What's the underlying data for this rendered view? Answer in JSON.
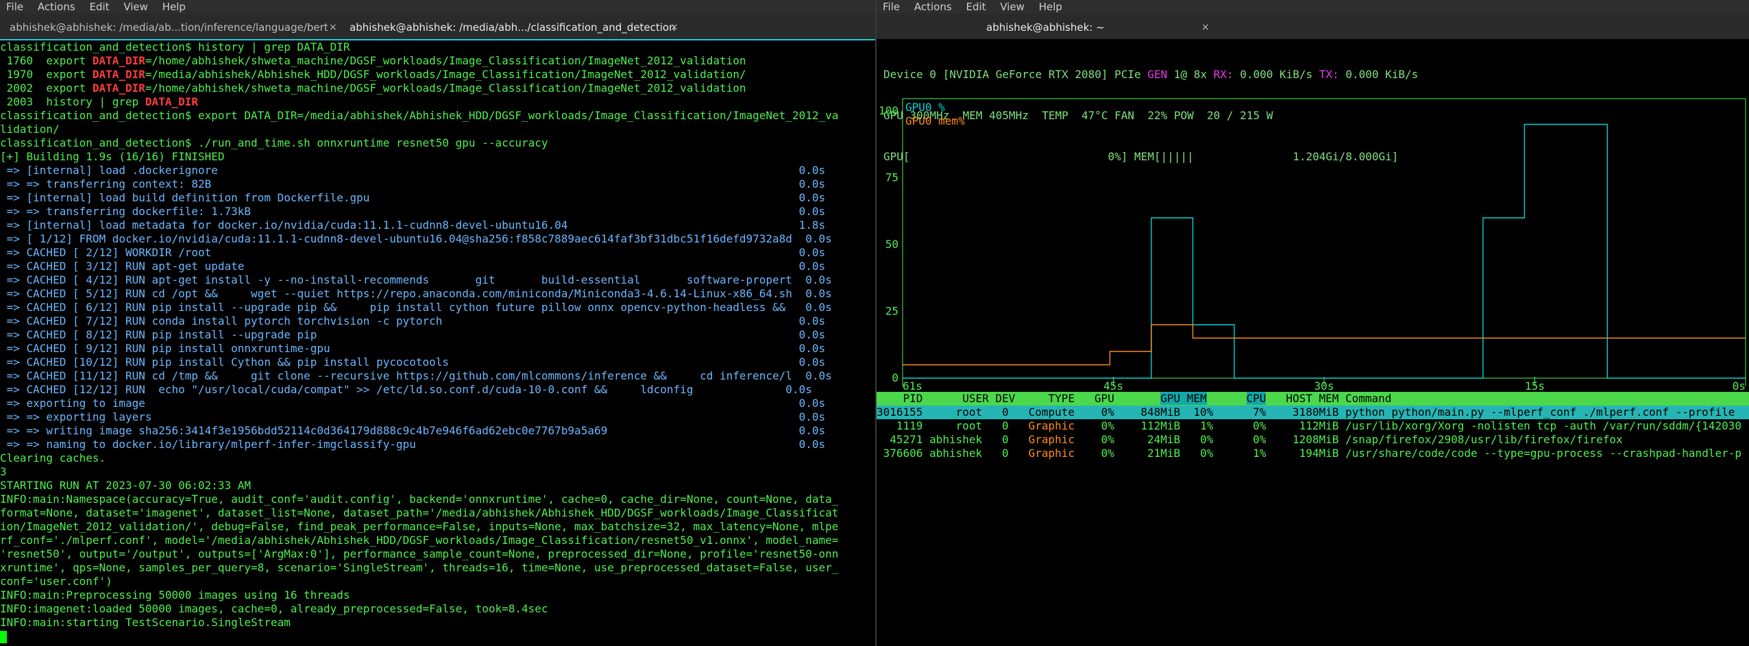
{
  "left": {
    "menu": [
      "File",
      "Actions",
      "Edit",
      "View",
      "Help"
    ],
    "tabs": [
      {
        "label": "abhishek@abhishek: /media/ab...tion/inference/language/bert",
        "active": false
      },
      {
        "label": "abhishek@abhishek: /media/abh.../classification_and_detection",
        "active": true
      }
    ],
    "lines": [
      {
        "parts": [
          {
            "t": "classification_and_detection$ history | grep DATA_DIR",
            "c": "g"
          }
        ]
      },
      {
        "parts": [
          {
            "t": " 1760  export ",
            "c": "g"
          },
          {
            "t": "DATA_DIR",
            "c": "r"
          },
          {
            "t": "=/home/abhishek/shweta_machine/DGSF_workloads/Image_Classification/ImageNet_2012_validation",
            "c": "g"
          }
        ]
      },
      {
        "parts": [
          {
            "t": " 1970  export ",
            "c": "g"
          },
          {
            "t": "DATA_DIR",
            "c": "r"
          },
          {
            "t": "=/media/abhishek/Abhishek_HDD/DGSF_workloads/Image_Classification/ImageNet_2012_validation/",
            "c": "g"
          }
        ]
      },
      {
        "parts": [
          {
            "t": " 2002  export ",
            "c": "g"
          },
          {
            "t": "DATA_DIR",
            "c": "r"
          },
          {
            "t": "=/home/abhishek/shweta_machine/DGSF_workloads/Image_Classification/ImageNet_2012_validation",
            "c": "g"
          }
        ]
      },
      {
        "parts": [
          {
            "t": " 2003  history | grep ",
            "c": "g"
          },
          {
            "t": "DATA_DIR",
            "c": "r"
          }
        ]
      },
      {
        "parts": [
          {
            "t": "classification_and_detection$ export DATA_DIR=/media/abhishek/Abhishek_HDD/DGSF_workloads/Image_Classification/ImageNet_2012_va",
            "c": "g"
          }
        ]
      },
      {
        "parts": [
          {
            "t": "lidation/",
            "c": "g"
          }
        ]
      },
      {
        "parts": [
          {
            "t": "classification_and_detection$ ./run_and_time.sh onnxruntime resnet50 gpu --accuracy",
            "c": "g"
          }
        ]
      },
      {
        "parts": [
          {
            "t": "[+] Building 1.9s (16/16) FINISHED",
            "c": "g"
          }
        ]
      },
      {
        "parts": [
          {
            "t": " => [internal] load .dockerignore                                                                                        0.0s",
            "c": "b"
          }
        ]
      },
      {
        "parts": [
          {
            "t": " => => transferring context: 82B                                                                                         0.0s",
            "c": "b"
          }
        ]
      },
      {
        "parts": [
          {
            "t": " => [internal] load build definition from Dockerfile.gpu                                                                 0.0s",
            "c": "b"
          }
        ]
      },
      {
        "parts": [
          {
            "t": " => => transferring dockerfile: 1.73kB                                                                                   0.0s",
            "c": "b"
          }
        ]
      },
      {
        "parts": [
          {
            "t": " => [internal] load metadata for docker.io/nvidia/cuda:11.1.1-cudnn8-devel-ubuntu16.04                                   1.8s",
            "c": "b"
          }
        ]
      },
      {
        "parts": [
          {
            "t": " => [ 1/12] FROM docker.io/nvidia/cuda:11.1.1-cudnn8-devel-ubuntu16.04@sha256:f858c7889aec614faf3bf31dbc51f16defd9732a8d  0.0s",
            "c": "b"
          }
        ]
      },
      {
        "parts": [
          {
            "t": " => CACHED [ 2/12] WORKDIR /root                                                                                         0.0s",
            "c": "b"
          }
        ]
      },
      {
        "parts": [
          {
            "t": " => CACHED [ 3/12] RUN apt-get update                                                                                    0.0s",
            "c": "b"
          }
        ]
      },
      {
        "parts": [
          {
            "t": " => CACHED [ 4/12] RUN apt-get install -y --no-install-recommends       git       build-essential       software-propert  0.0s",
            "c": "b"
          }
        ]
      },
      {
        "parts": [
          {
            "t": " => CACHED [ 5/12] RUN cd /opt &&     wget --quiet https://repo.anaconda.com/miniconda/Miniconda3-4.6.14-Linux-x86_64.sh  0.0s",
            "c": "b"
          }
        ]
      },
      {
        "parts": [
          {
            "t": " => CACHED [ 6/12] RUN pip install --upgrade pip &&     pip install cython future pillow onnx opencv-python-headless &&   0.0s",
            "c": "b"
          }
        ]
      },
      {
        "parts": [
          {
            "t": " => CACHED [ 7/12] RUN conda install pytorch torchvision -c pytorch                                                      0.0s",
            "c": "b"
          }
        ]
      },
      {
        "parts": [
          {
            "t": " => CACHED [ 8/12] RUN pip install --upgrade pip                                                                         0.0s",
            "c": "b"
          }
        ]
      },
      {
        "parts": [
          {
            "t": " => CACHED [ 9/12] RUN pip install onnxruntime-gpu                                                                       0.0s",
            "c": "b"
          }
        ]
      },
      {
        "parts": [
          {
            "t": " => CACHED [10/12] RUN pip install Cython && pip install pycocotools                                                     0.0s",
            "c": "b"
          }
        ]
      },
      {
        "parts": [
          {
            "t": " => CACHED [11/12] RUN cd /tmp &&     git clone --recursive https://github.com/mlcommons/inference &&     cd inference/l  0.0s",
            "c": "b"
          }
        ]
      },
      {
        "parts": [
          {
            "t": " => CACHED [12/12] RUN  echo \"/usr/local/cuda/compat\" >> /etc/ld.so.conf.d/cuda-10-0.conf &&     ldconfig              0.0s",
            "c": "b"
          }
        ]
      },
      {
        "parts": [
          {
            "t": " => exporting to image                                                                                                   0.0s",
            "c": "b"
          }
        ]
      },
      {
        "parts": [
          {
            "t": " => => exporting layers                                                                                                  0.0s",
            "c": "b"
          }
        ]
      },
      {
        "parts": [
          {
            "t": " => => writing image sha256:3414f3e1956bdd52114c0d364179d888c9c4b7e946f6ad62ebc0e7767b9a5a69                             0.0s",
            "c": "b"
          }
        ]
      },
      {
        "parts": [
          {
            "t": " => => naming to docker.io/library/mlperf-infer-imgclassify-gpu                                                          0.0s",
            "c": "b"
          }
        ]
      },
      {
        "parts": [
          {
            "t": "Clearing caches.",
            "c": "g"
          }
        ]
      },
      {
        "parts": [
          {
            "t": "3",
            "c": "g"
          }
        ]
      },
      {
        "parts": [
          {
            "t": "STARTING RUN AT 2023-07-30 06:02:33 AM",
            "c": "g"
          }
        ]
      },
      {
        "parts": [
          {
            "t": "INFO:main:Namespace(accuracy=True, audit_conf='audit.config', backend='onnxruntime', cache=0, cache_dir=None, count=None, data_",
            "c": "g"
          }
        ]
      },
      {
        "parts": [
          {
            "t": "format=None, dataset='imagenet', dataset_list=None, dataset_path='/media/abhishek/Abhishek_HDD/DGSF_workloads/Image_Classificat",
            "c": "g"
          }
        ]
      },
      {
        "parts": [
          {
            "t": "ion/ImageNet_2012_validation/', debug=False, find_peak_performance=False, inputs=None, max_batchsize=32, max_latency=None, mlpe",
            "c": "g"
          }
        ]
      },
      {
        "parts": [
          {
            "t": "rf_conf='./mlperf.conf', model='/media/abhishek/Abhishek_HDD/DGSF_workloads/Image_Classification/resnet50_v1.onnx', model_name=",
            "c": "g"
          }
        ]
      },
      {
        "parts": [
          {
            "t": "'resnet50', output='/output', outputs=['ArgMax:0'], performance_sample_count=None, preprocessed_dir=None, profile='resnet50-onn",
            "c": "g"
          }
        ]
      },
      {
        "parts": [
          {
            "t": "xruntime', qps=None, samples_per_query=8, scenario='SingleStream', threads=16, time=None, use_preprocessed_dataset=False, user_",
            "c": "g"
          }
        ]
      },
      {
        "parts": [
          {
            "t": "conf='user.conf')",
            "c": "g"
          }
        ]
      },
      {
        "parts": [
          {
            "t": "INFO:main:Preprocessing 50000 images using 16 threads",
            "c": "g"
          }
        ]
      },
      {
        "parts": [
          {
            "t": "INFO:imagenet:loaded 50000 images, cache=0, already_preprocessed=False, took=8.4sec",
            "c": "g"
          }
        ]
      },
      {
        "parts": [
          {
            "t": "INFO:main:starting TestScenario.SingleStream",
            "c": "g"
          }
        ]
      }
    ]
  },
  "right": {
    "menu": [
      "File",
      "Actions",
      "Edit",
      "View",
      "Help"
    ],
    "tab_label": "abhishek@abhishek: ~",
    "device_line": {
      "prefix": "Device 0 [NVIDIA GeForce RTX 2080] PCIe ",
      "gen_label": "GEN",
      "gen_value": " 1@ 8x ",
      "rx_label": "RX:",
      "rx_value": " 0.000 KiB/s ",
      "tx_label": "TX:",
      "tx_value": " 0.000 KiB/s"
    },
    "stats_line": "GPU 300MHz  MEM 405MHz  TEMP  47°C FAN  22% POW  20 / 215 W",
    "gpu_bar_line": "GPU[                              0%] MEM[|||||               1.204Gi/8.000Gi]",
    "chart_data": {
      "type": "line",
      "title": "",
      "xlabel": "",
      "ylabel": "",
      "ylim": [
        0,
        100
      ],
      "y_ticks": [
        "100",
        "75",
        "50",
        "25",
        "0"
      ],
      "x_ticks": [
        "61s",
        "45s",
        "30s",
        "15s",
        "0s"
      ],
      "x": [
        61,
        58,
        55,
        52,
        49,
        46,
        43,
        40,
        37,
        34,
        31,
        28,
        25,
        22,
        19,
        16,
        13,
        10,
        7,
        4,
        1
      ],
      "series": [
        {
          "name": "GPU0 %",
          "color": "#00d7d7",
          "values": [
            0,
            0,
            0,
            0,
            0,
            0,
            0,
            60,
            20,
            0,
            0,
            0,
            0,
            0,
            0,
            60,
            95,
            95,
            0,
            0,
            0
          ]
        },
        {
          "name": "GPU0 mem%",
          "color": "#ff8c1a",
          "values": [
            5,
            5,
            5,
            5,
            5,
            5,
            10,
            20,
            15,
            15,
            15,
            15,
            15,
            15,
            15,
            15,
            15,
            15,
            15,
            15,
            15
          ]
        }
      ]
    },
    "table": {
      "headers": [
        "PID",
        "USER",
        "DEV",
        "TYPE",
        "GPU",
        "GPU MEM",
        "CPU",
        "HOST MEM",
        "Command"
      ],
      "rows": [
        {
          "pid": "3016155",
          "user": "root",
          "dev": "0",
          "type": "Compute",
          "gpu": "0%",
          "gpu_mem": "848MiB",
          "gpu_mem_pct": "10%",
          "cpu": "7%",
          "host_mem": "3180MiB",
          "command": "python python/main.py --mlperf_conf ./mlperf.conf --profile",
          "selected": true
        },
        {
          "pid": "1119",
          "user": "root",
          "dev": "0",
          "type": "Graphic",
          "gpu": "0%",
          "gpu_mem": "112MiB",
          "gpu_mem_pct": "1%",
          "cpu": "0%",
          "host_mem": "112MiB",
          "command": "/usr/lib/xorg/Xorg -nolisten tcp -auth /var/run/sddm/{142030",
          "selected": false
        },
        {
          "pid": "45271",
          "user": "abhishek",
          "dev": "0",
          "type": "Graphic",
          "gpu": "0%",
          "gpu_mem": "24MiB",
          "gpu_mem_pct": "0%",
          "cpu": "0%",
          "host_mem": "1208MiB",
          "command": "/snap/firefox/2908/usr/lib/firefox/firefox",
          "selected": false
        },
        {
          "pid": "376606",
          "user": "abhishek",
          "dev": "0",
          "type": "Graphic",
          "gpu": "0%",
          "gpu_mem": "21MiB",
          "gpu_mem_pct": "0%",
          "cpu": "1%",
          "host_mem": "194MiB",
          "command": "/usr/share/code/code --type=gpu-process --crashpad-handler-p",
          "selected": false
        }
      ]
    }
  }
}
